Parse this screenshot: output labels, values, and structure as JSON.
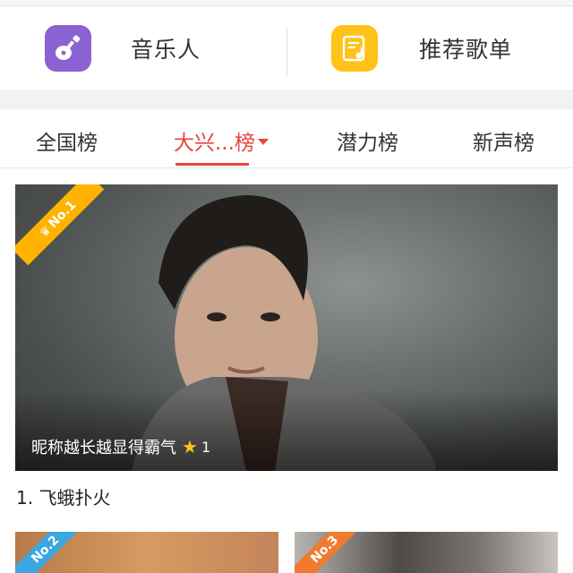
{
  "quick_links": [
    {
      "label": "音乐人",
      "icon": "guitar-icon",
      "color": "#8a63d2"
    },
    {
      "label": "推荐歌单",
      "icon": "playlist-icon",
      "color": "#ffc21a"
    }
  ],
  "tabs": [
    {
      "label": "全国榜"
    },
    {
      "label": "大兴...榜",
      "active": true
    },
    {
      "label": "潜力榜"
    },
    {
      "label": "新声榜"
    }
  ],
  "accent_color": "#e8463c",
  "featured": {
    "rank_badge": "No.1",
    "nickname": "昵称越长越显得霸气",
    "star_count": "1",
    "title": "1. 飞蛾扑火"
  },
  "cards": [
    {
      "rank_badge": "No.2",
      "badge_color": "#3aa7e0"
    },
    {
      "rank_badge": "No.3",
      "badge_color": "#f07a30"
    }
  ]
}
